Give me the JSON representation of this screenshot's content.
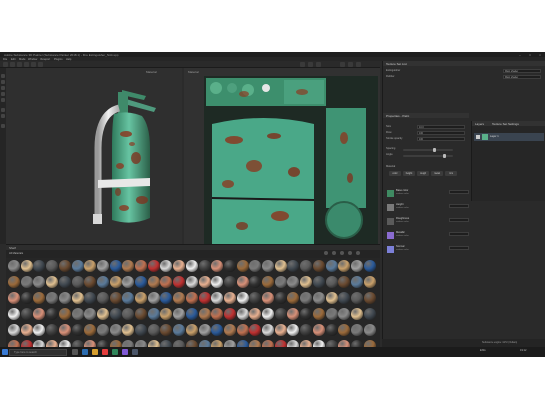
{
  "app": {
    "title": "Adobe Substance 3D Painter (Substance Painter 2018.1) - Fire Extinguisher_Nick.spp"
  },
  "menu": [
    "File",
    "Edit",
    "Mode",
    "Window",
    "Viewport",
    "Plugins",
    "Help"
  ],
  "viewport": {
    "label_3d": "Material",
    "label_2d": "Material"
  },
  "shelf": {
    "title": "Shelf",
    "tab": "All Materials",
    "search_placeholder": "Search..."
  },
  "texture_set_list": {
    "title": "Texture Set List",
    "items": [
      {
        "name": "Extinguisher",
        "shader": "Main shader"
      },
      {
        "name": "Rubber",
        "shader": "Main shader"
      }
    ]
  },
  "properties": {
    "title": "Properties - Paint",
    "rows": [
      {
        "label": "Size",
        "value": "10.0"
      },
      {
        "label": "Flow",
        "value": "100"
      },
      {
        "label": "Stroke opacity",
        "value": "100"
      },
      {
        "label": "Spacing",
        "value": "10"
      },
      {
        "label": "Angle",
        "value": "0"
      }
    ],
    "channel_header": "Material",
    "channel_buttons": [
      "color",
      "height",
      "rough",
      "metal",
      "nrm"
    ],
    "channels": [
      {
        "name": "Base color",
        "sub": "uniform color",
        "color": "#3f8a62"
      },
      {
        "name": "Height",
        "sub": "uniform color",
        "color": "#7a7a7a"
      },
      {
        "name": "Roughness",
        "sub": "uniform color",
        "color": "#5a5a5a"
      },
      {
        "name": "Metallic",
        "sub": "uniform color",
        "color": "#8a6bd0"
      },
      {
        "name": "Normal",
        "sub": "uniform color",
        "color": "#7c80d8"
      }
    ]
  },
  "layers": {
    "title": "Layers",
    "tab": "Texture Set Settings",
    "items": [
      {
        "name": "Layer 1"
      }
    ]
  },
  "statusbar": {
    "text": "Substance engine: GPU (Vulkan)"
  },
  "taskbar": {
    "search_placeholder": "Type here to search",
    "time": "19:12",
    "lang": "ENG"
  },
  "colors": {
    "accent": "#3aa89a",
    "rust": "#8a3a22",
    "paint": "#4aa888"
  }
}
